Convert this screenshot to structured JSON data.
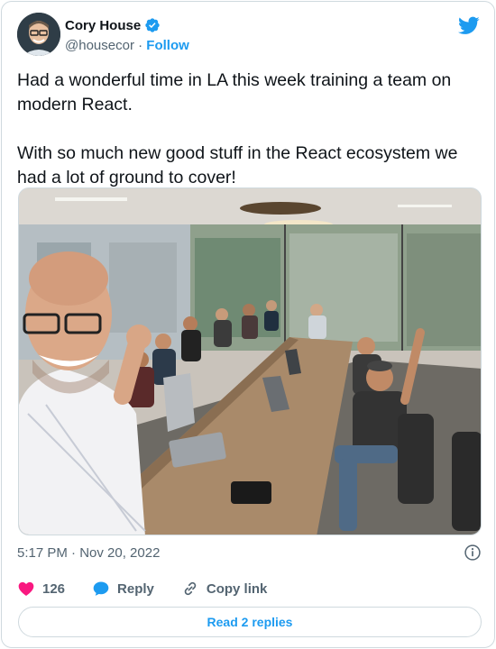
{
  "author": {
    "name": "Cory House",
    "handle": "@housecor",
    "separator": " · ",
    "follow_label": "Follow"
  },
  "tweet": {
    "text": "Had a wonderful time in LA this week training a team on modern React.\n\nWith so much new good stuff in the React ecosystem we had a lot of ground to cover!",
    "timestamp": "5:17 PM · Nov 20, 2022"
  },
  "actions": {
    "like_count": "126",
    "reply_label": "Reply",
    "copy_link_label": "Copy link"
  },
  "read_replies_label": "Read 2 replies",
  "colors": {
    "brand_blue": "#1d9bf0",
    "like_red": "#f91880",
    "secondary_text": "#536471"
  }
}
